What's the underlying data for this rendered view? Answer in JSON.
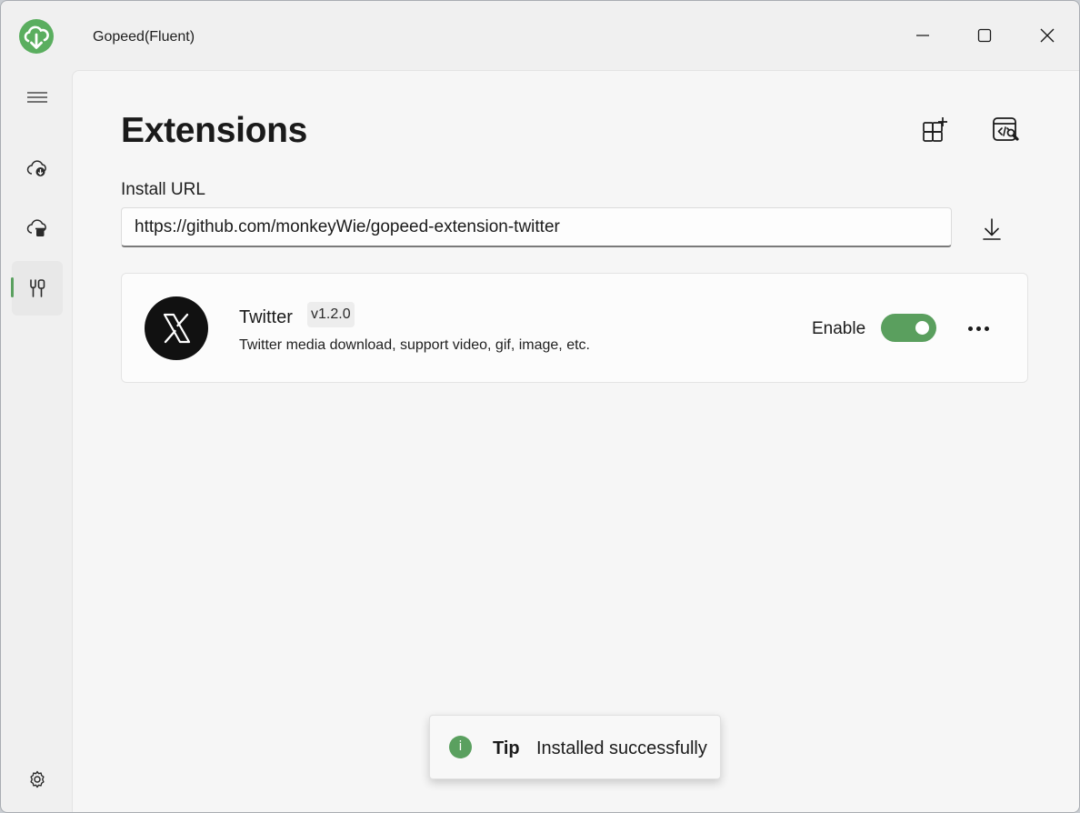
{
  "window": {
    "title": "Gopeed(Fluent)"
  },
  "page": {
    "title": "Extensions",
    "install_url_label": "Install URL",
    "install_url_value": "https://github.com/monkeyWie/gopeed-extension-twitter"
  },
  "nav": {
    "items": [
      {
        "icon": "menu-icon"
      },
      {
        "icon": "cloud-download-icon"
      },
      {
        "icon": "cloud-delete-icon"
      },
      {
        "icon": "extension-tools-icon",
        "active": true
      },
      {
        "icon": "gear-icon"
      }
    ]
  },
  "extensions": [
    {
      "name": "Twitter",
      "version": "v1.2.0",
      "description": "Twitter media download, support video, gif, image, etc.",
      "enable_label": "Enable",
      "enabled": true,
      "icon": "x-logo-icon"
    }
  ],
  "toast": {
    "icon": "info-icon",
    "icon_glyph": "i",
    "title": "Tip",
    "message": "Installed successfully"
  },
  "colors": {
    "accent": "#5aa05f",
    "logo": "#5aae5f"
  }
}
